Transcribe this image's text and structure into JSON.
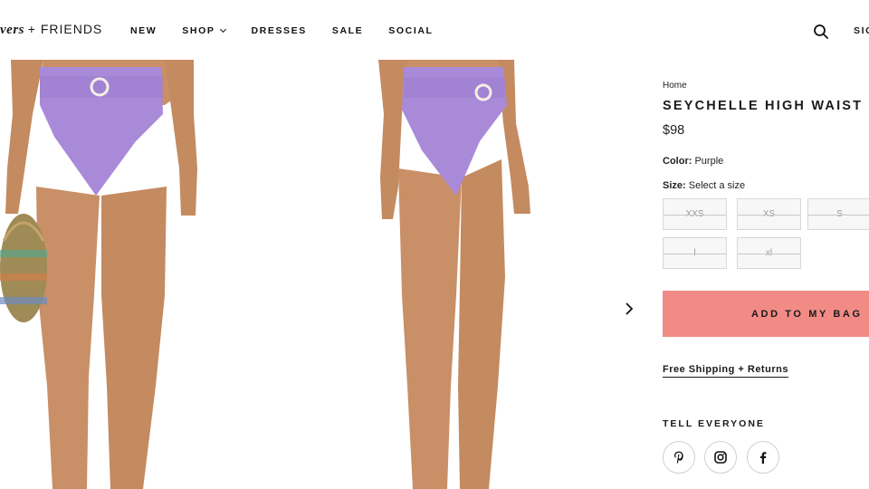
{
  "header": {
    "logo_script": "vers",
    "logo_plain": "+ FRIENDS",
    "nav": [
      {
        "label": "NEW"
      },
      {
        "label": "SHOP"
      },
      {
        "label": "DRESSES"
      },
      {
        "label": "SALE"
      },
      {
        "label": "SOCIAL"
      }
    ],
    "signin_label": "SIG",
    "search_icon": "search-icon"
  },
  "product": {
    "breadcrumb": "Home",
    "title": "SEYCHELLE HIGH WAIST",
    "price": "$98",
    "color_label": "Color:",
    "color_value": "Purple",
    "size_label": "Size:",
    "size_value": "Select a size",
    "sizes": [
      "XXS",
      "XS",
      "S",
      "l",
      "xl"
    ],
    "add_to_bag": "ADD TO MY BAG",
    "shipping_link": "Free Shipping + Returns",
    "share_heading": "TELL EVERYONE",
    "swimsuit_color": "#a98ad8"
  }
}
